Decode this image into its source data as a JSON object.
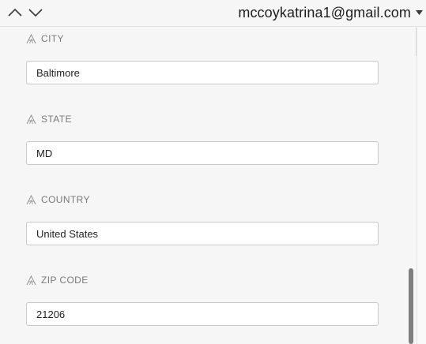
{
  "header": {
    "account_email": "mccoykatrina1@gmail.com"
  },
  "fields": [
    {
      "label": "CITY",
      "value": "Baltimore"
    },
    {
      "label": "STATE",
      "value": "MD"
    },
    {
      "label": "COUNTRY",
      "value": "United States"
    },
    {
      "label": "ZIP CODE",
      "value": "21206"
    }
  ],
  "icons": {
    "nav_up": "chevron-up-icon",
    "nav_down": "chevron-down-icon",
    "account_caret": "caret-down-icon",
    "field_label": "text-field-icon"
  },
  "colors": {
    "background": "#f6f6f6",
    "input_border": "#c9c9c9",
    "label_text": "#7a7a7a",
    "scroll_thumb": "#7f7f7f"
  }
}
